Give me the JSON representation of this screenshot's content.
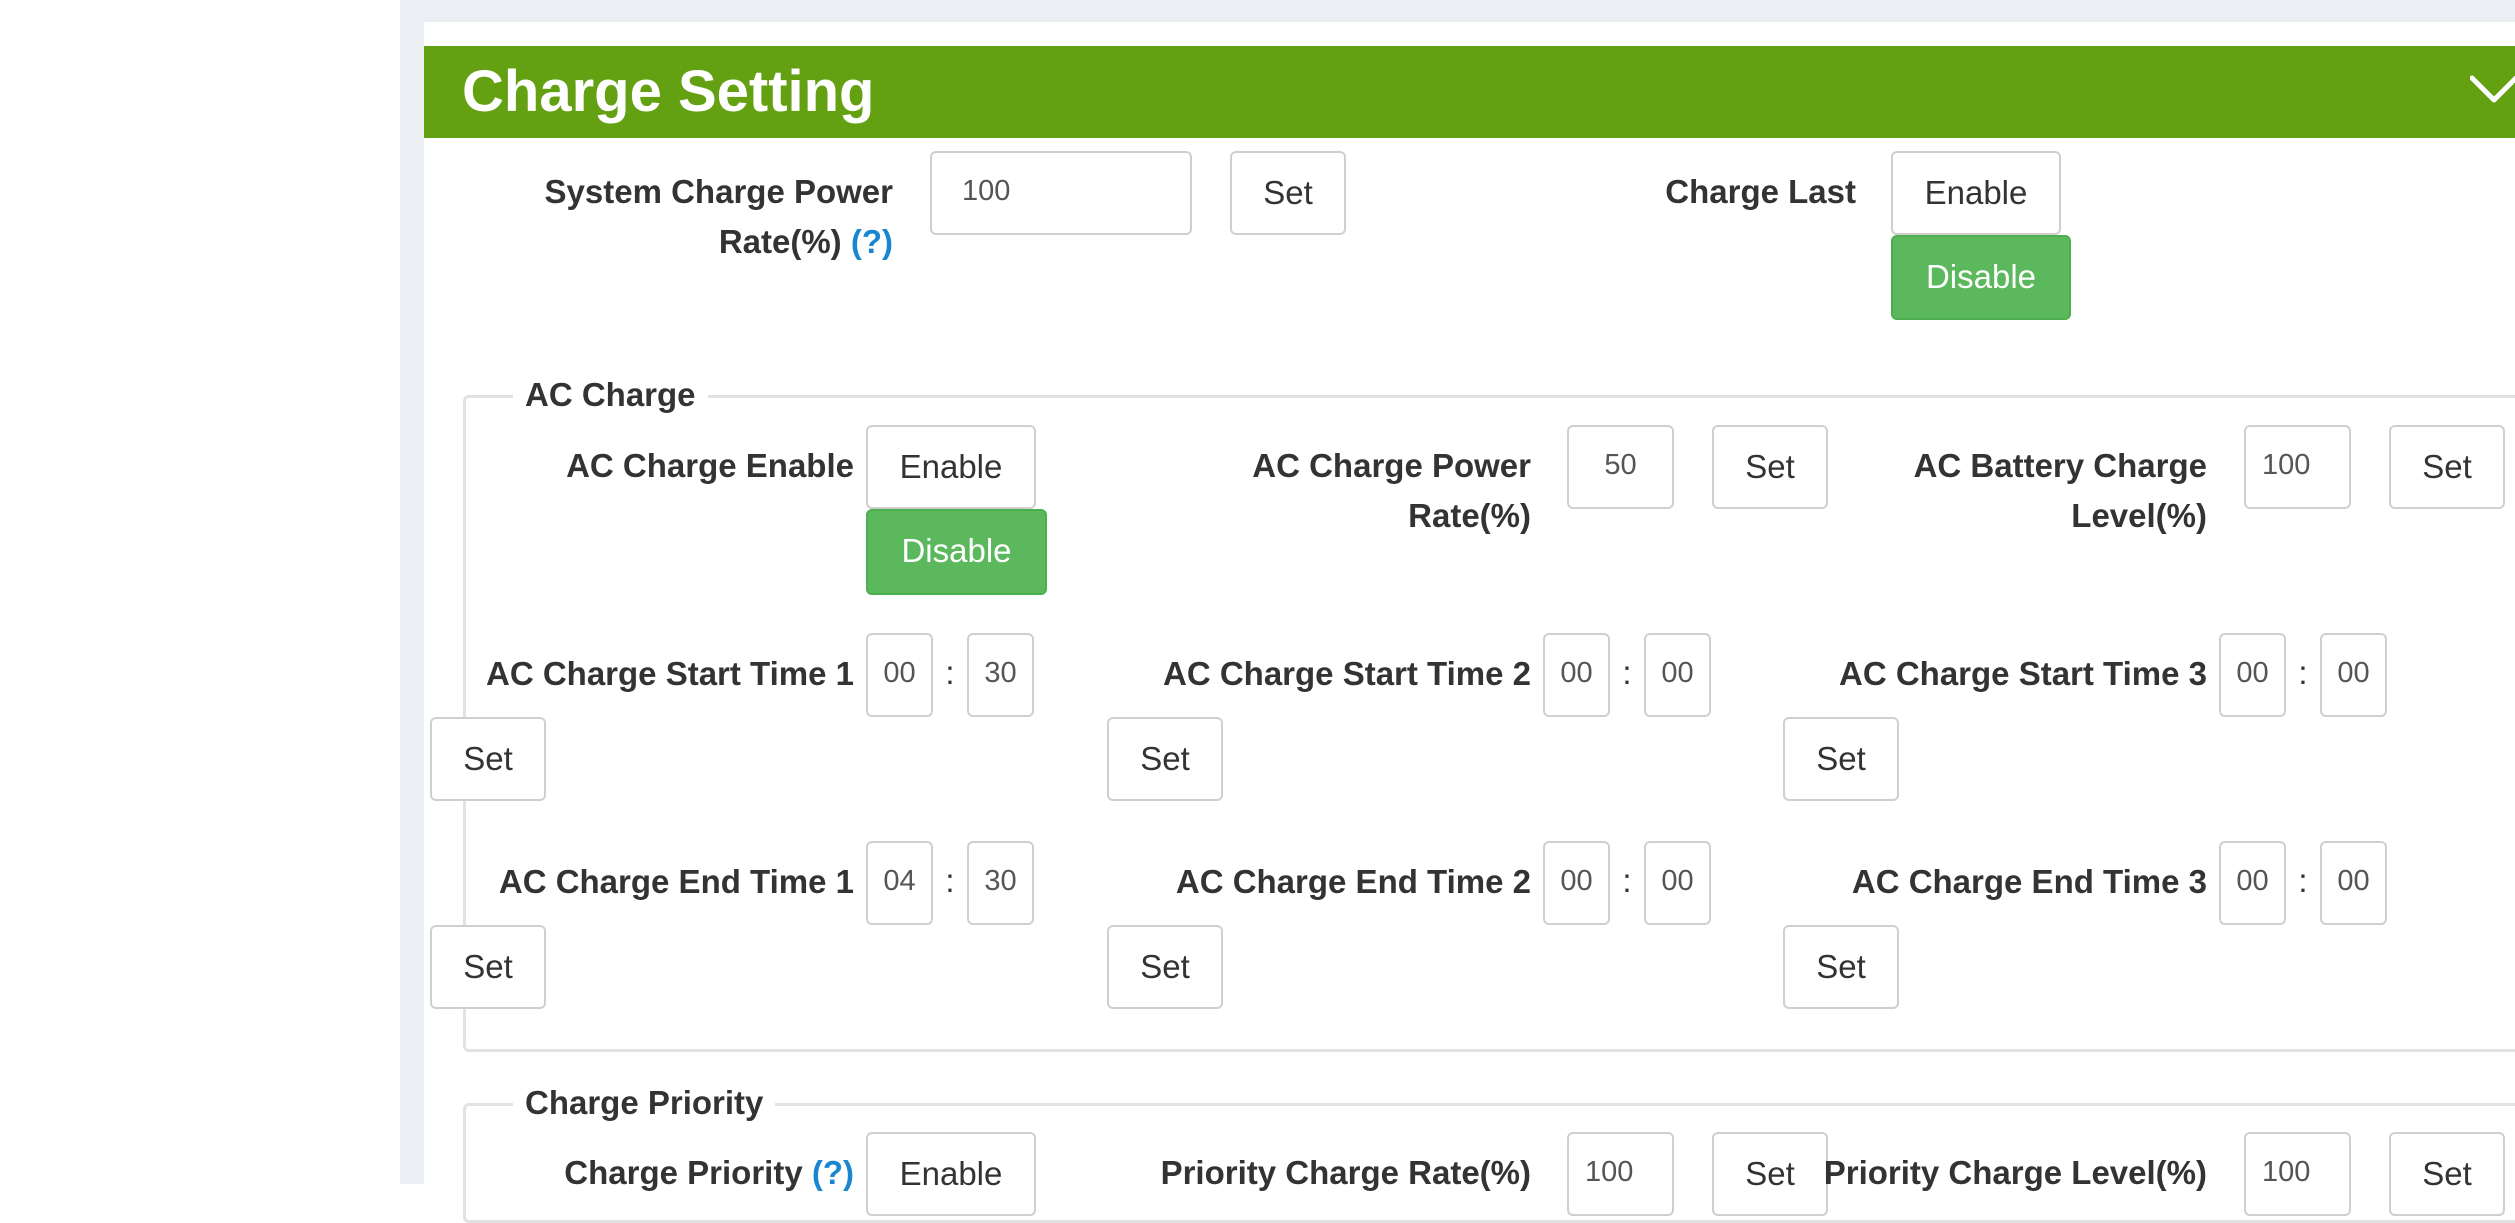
{
  "panel": {
    "title": "Charge Setting",
    "chevron_icon": "chevron-down-icon",
    "header_color": "#63a012"
  },
  "system_charge": {
    "label_line1": "System Charge Power",
    "label_line2": "Rate(%)",
    "help": "(?)",
    "value": "100",
    "set_label": "Set"
  },
  "charge_last": {
    "label": "Charge Last",
    "enable_label": "Enable",
    "disable_label": "Disable"
  },
  "ac_charge": {
    "legend": "AC Charge",
    "enable_label": "AC Charge Enable",
    "enable_btn": "Enable",
    "disable_btn": "Disable",
    "power_label_line1": "AC Charge Power",
    "power_label_line2": "Rate(%)",
    "power_value": "50",
    "battery_label_line1": "AC Battery Charge",
    "battery_label_line2": "Level(%)",
    "battery_value": "100",
    "set_label": "Set",
    "start_times": [
      {
        "label": "AC Charge Start Time 1",
        "hour": "00",
        "minute": "30"
      },
      {
        "label": "AC Charge Start Time 2",
        "hour": "00",
        "minute": "00"
      },
      {
        "label": "AC Charge Start Time 3",
        "hour": "00",
        "minute": "00"
      }
    ],
    "end_times": [
      {
        "label": "AC Charge End Time 1",
        "hour": "04",
        "minute": "30"
      },
      {
        "label": "AC Charge End Time 2",
        "hour": "00",
        "minute": "00"
      },
      {
        "label": "AC Charge End Time 3",
        "hour": "00",
        "minute": "00"
      }
    ],
    "colon": ":"
  },
  "charge_priority": {
    "legend": "Charge Priority",
    "priority_label": "Charge Priority",
    "help": "(?)",
    "enable_btn": "Enable",
    "rate_label": "Priority Charge Rate(%)",
    "rate_value": "100",
    "level_label": "Priority Charge Level(%)",
    "level_value": "100",
    "set_label": "Set"
  },
  "colors": {
    "accent_green": "#5cb85c",
    "help_link": "#1a86d0"
  }
}
